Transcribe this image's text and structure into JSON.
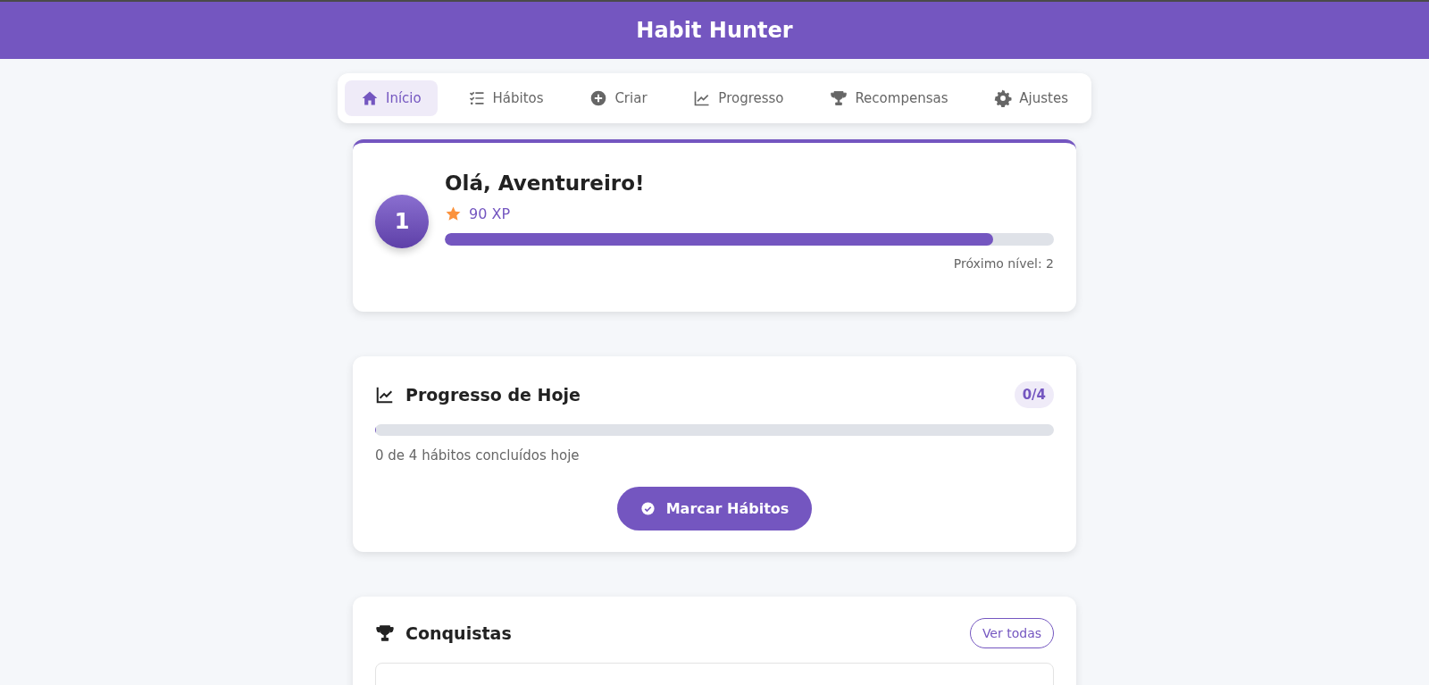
{
  "header": {
    "title": "Habit Hunter"
  },
  "nav": [
    {
      "label": "Início",
      "kind": "home",
      "selected": true
    },
    {
      "label": "Hábitos",
      "kind": "list",
      "selected": false
    },
    {
      "label": "Criar",
      "kind": "plus",
      "selected": false
    },
    {
      "label": "Progresso",
      "kind": "chart",
      "selected": false
    },
    {
      "label": "Recompensas",
      "kind": "trophy",
      "selected": false
    },
    {
      "label": "Ajustes",
      "kind": "gear",
      "selected": false
    }
  ],
  "profile": {
    "level_badge": "1",
    "greeting": "Olá, Aventureiro!",
    "xp": "90 XP",
    "level": 0.9,
    "next_level": "Próximo nível: 2"
  },
  "today": {
    "title": "Progresso de Hoje",
    "count": "0/4",
    "level": 0,
    "summary": "0 de 4 hábitos concluídos hoje",
    "button": "Marcar Hábitos"
  },
  "achievements": {
    "title": "Conquistas",
    "button": "Ver todas"
  }
}
